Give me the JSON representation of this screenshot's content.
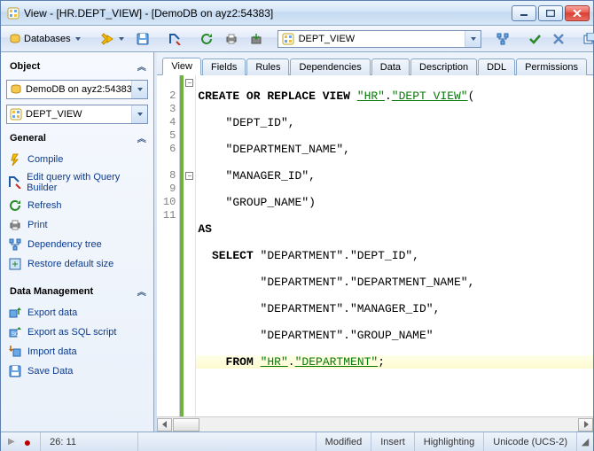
{
  "window": {
    "title": "View - [HR.DEPT_VIEW] - [DemoDB on ayz2:54383]"
  },
  "toolbar": {
    "databases_label": "Databases",
    "combo_value": "DEPT_VIEW"
  },
  "sidebar": {
    "object_head": "Object",
    "db_combo": "DemoDB on ayz2:54383",
    "view_combo": "DEPT_VIEW",
    "general_head": "General",
    "general_items": [
      "Compile",
      "Edit query with Query Builder",
      "Refresh",
      "Print",
      "Dependency tree",
      "Restore default size"
    ],
    "data_head": "Data Management",
    "data_items": [
      "Export data",
      "Export as SQL script",
      "Import data",
      "Save Data"
    ]
  },
  "tabs": [
    "View",
    "Fields",
    "Rules",
    "Dependencies",
    "Data",
    "Description",
    "DDL",
    "Permissions"
  ],
  "code": {
    "lines": [
      "CREATE OR REPLACE VIEW \"HR\".\"DEPT_VIEW\"(",
      "    \"DEPT_ID\",",
      "    \"DEPARTMENT_NAME\",",
      "    \"MANAGER_ID\",",
      "    \"GROUP_NAME\")",
      "AS",
      "  SELECT \"DEPARTMENT\".\"DEPT_ID\",",
      "         \"DEPARTMENT\".\"DEPARTMENT_NAME\",",
      "         \"DEPARTMENT\".\"MANAGER_ID\",",
      "         \"DEPARTMENT\".\"GROUP_NAME\"",
      "    FROM \"HR\".\"DEPARTMENT\";"
    ],
    "line_numbers": [
      "",
      "2",
      "3",
      "4",
      "5",
      "6",
      "",
      "8",
      "9",
      "10",
      "11"
    ]
  },
  "statusbar": {
    "cursor": "26:  11",
    "modified": "Modified",
    "mode": "Insert",
    "highlight": "Highlighting",
    "encoding": "Unicode (UCS-2)"
  }
}
